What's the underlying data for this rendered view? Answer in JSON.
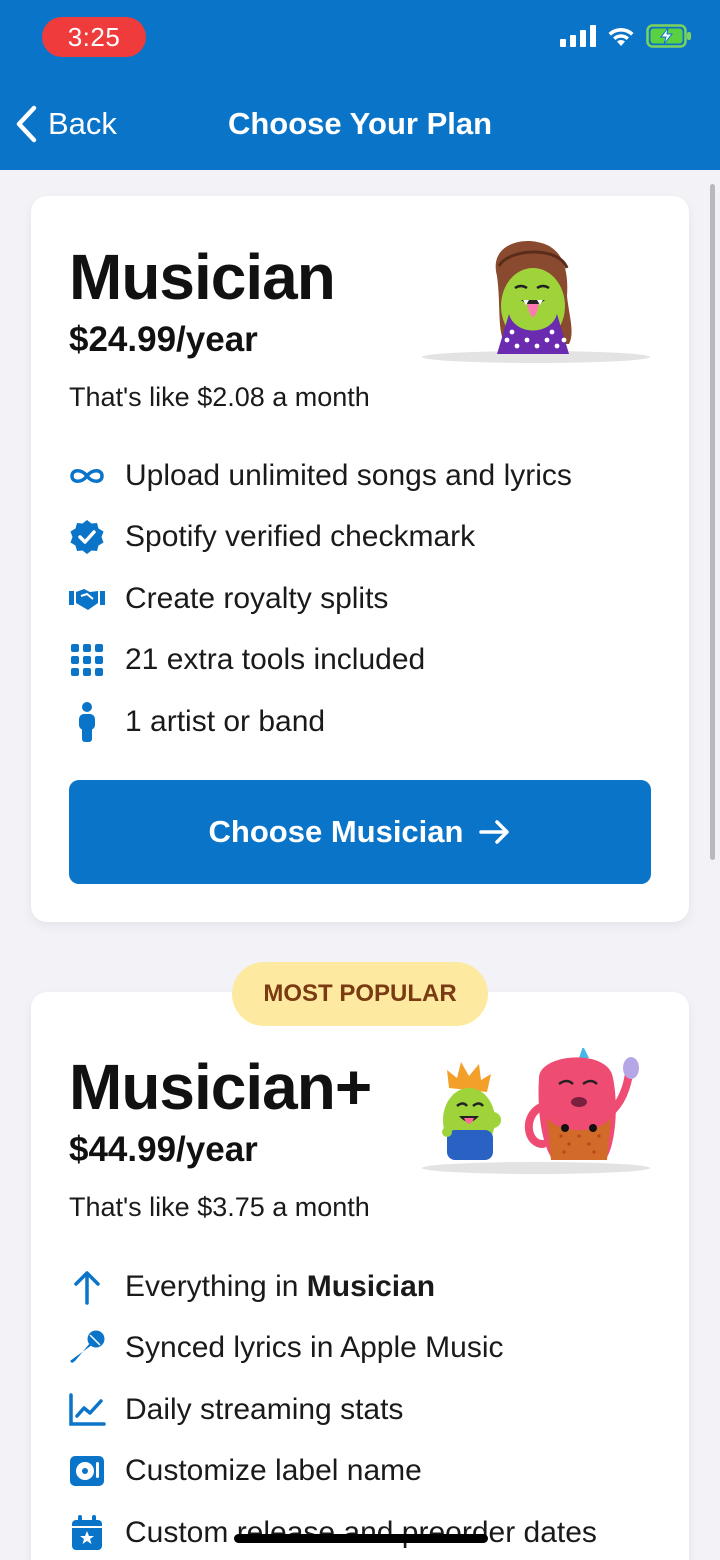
{
  "status_bar": {
    "time": "3:25"
  },
  "nav": {
    "back_label": "Back",
    "title": "Choose Your Plan"
  },
  "colors": {
    "brand_blue": "#0a74c9",
    "badge_bg": "#fde9a0",
    "badge_text": "#7a3b12",
    "recording_red": "#ef3b3b"
  },
  "plans": [
    {
      "name": "Musician",
      "price": "$24.99/year",
      "note": "That's like $2.08 a month",
      "features": [
        {
          "icon": "infinity-icon",
          "text": "Upload unlimited songs and lyrics"
        },
        {
          "icon": "verified-badge-icon",
          "text": "Spotify verified checkmark"
        },
        {
          "icon": "handshake-icon",
          "text": "Create royalty splits"
        },
        {
          "icon": "grid-icon",
          "text": "21 extra tools included"
        },
        {
          "icon": "person-icon",
          "text": "1 artist or band"
        }
      ],
      "cta": "Choose Musician"
    },
    {
      "badge": "MOST POPULAR",
      "name": "Musician+",
      "price": "$44.99/year",
      "note": "That's like $3.75 a month",
      "features": [
        {
          "icon": "arrow-up-icon",
          "text_prefix": "Everything in ",
          "text_bold": "Musician"
        },
        {
          "icon": "microphone-icon",
          "text": "Synced lyrics in Apple Music"
        },
        {
          "icon": "line-chart-icon",
          "text": "Daily streaming stats"
        },
        {
          "icon": "record-label-icon",
          "text": "Customize label name"
        },
        {
          "icon": "calendar-star-icon",
          "text": "Custom release and preorder dates"
        }
      ]
    }
  ]
}
